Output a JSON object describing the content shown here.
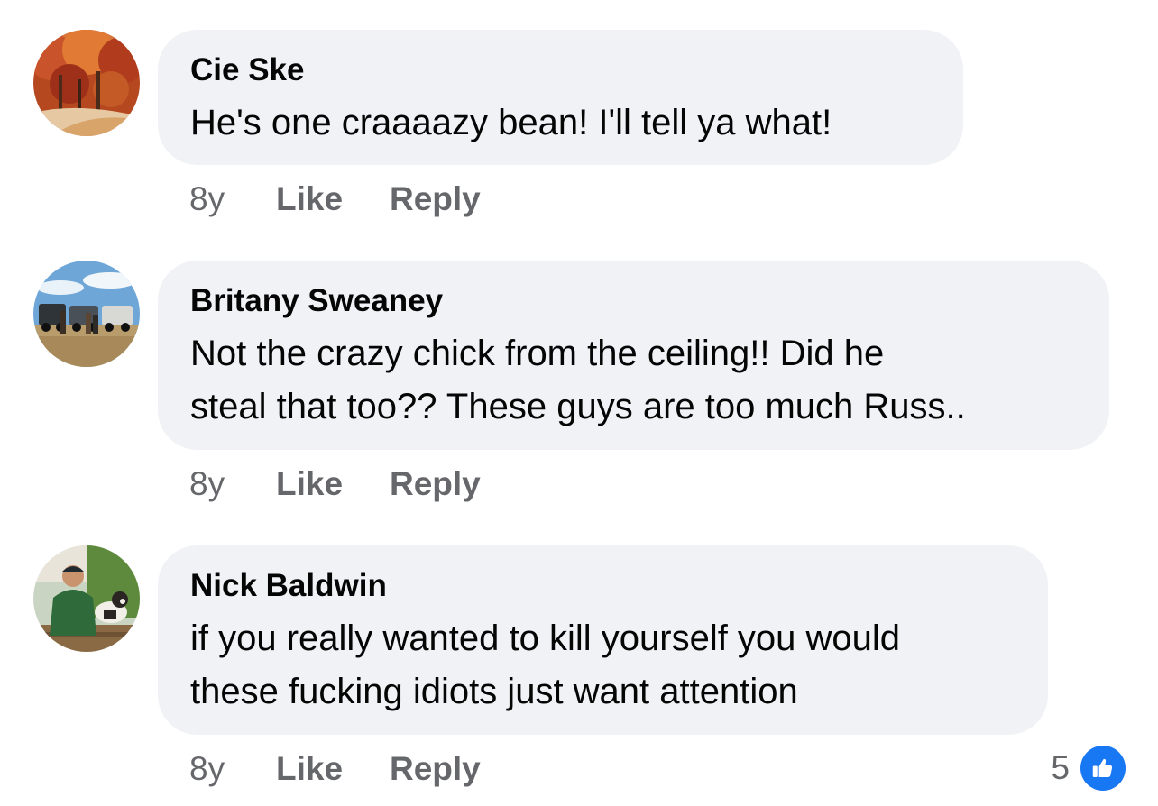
{
  "comments": [
    {
      "author": "Cie Ske",
      "lines": [
        "He's one craaaazy bean! I'll tell ya what!"
      ],
      "time": "8y",
      "like_label": "Like",
      "reply_label": "Reply",
      "avatar": "autumn-trees-photo"
    },
    {
      "author": "Britany Sweaney",
      "lines": [
        "Not the crazy chick from the ceiling!! Did he",
        "steal that too?? These guys are too much Russ.."
      ],
      "time": "8y",
      "like_label": "Like",
      "reply_label": "Reply",
      "avatar": "jeeps-group-photo"
    },
    {
      "author": "Nick Baldwin",
      "lines": [
        "if you really wanted to kill yourself you would",
        "these fucking idiots just want attention"
      ],
      "time": "8y",
      "like_label": "Like",
      "reply_label": "Reply",
      "avatar": "man-with-dog-photo",
      "reactions": {
        "count": "5",
        "icon": "thumbs-up-icon",
        "color": "#1877f2"
      }
    }
  ],
  "colors": {
    "bubble": "#f0f2f5",
    "secondary_text": "#65676b",
    "primary_text": "#050505",
    "like_blue": "#1877f2"
  }
}
